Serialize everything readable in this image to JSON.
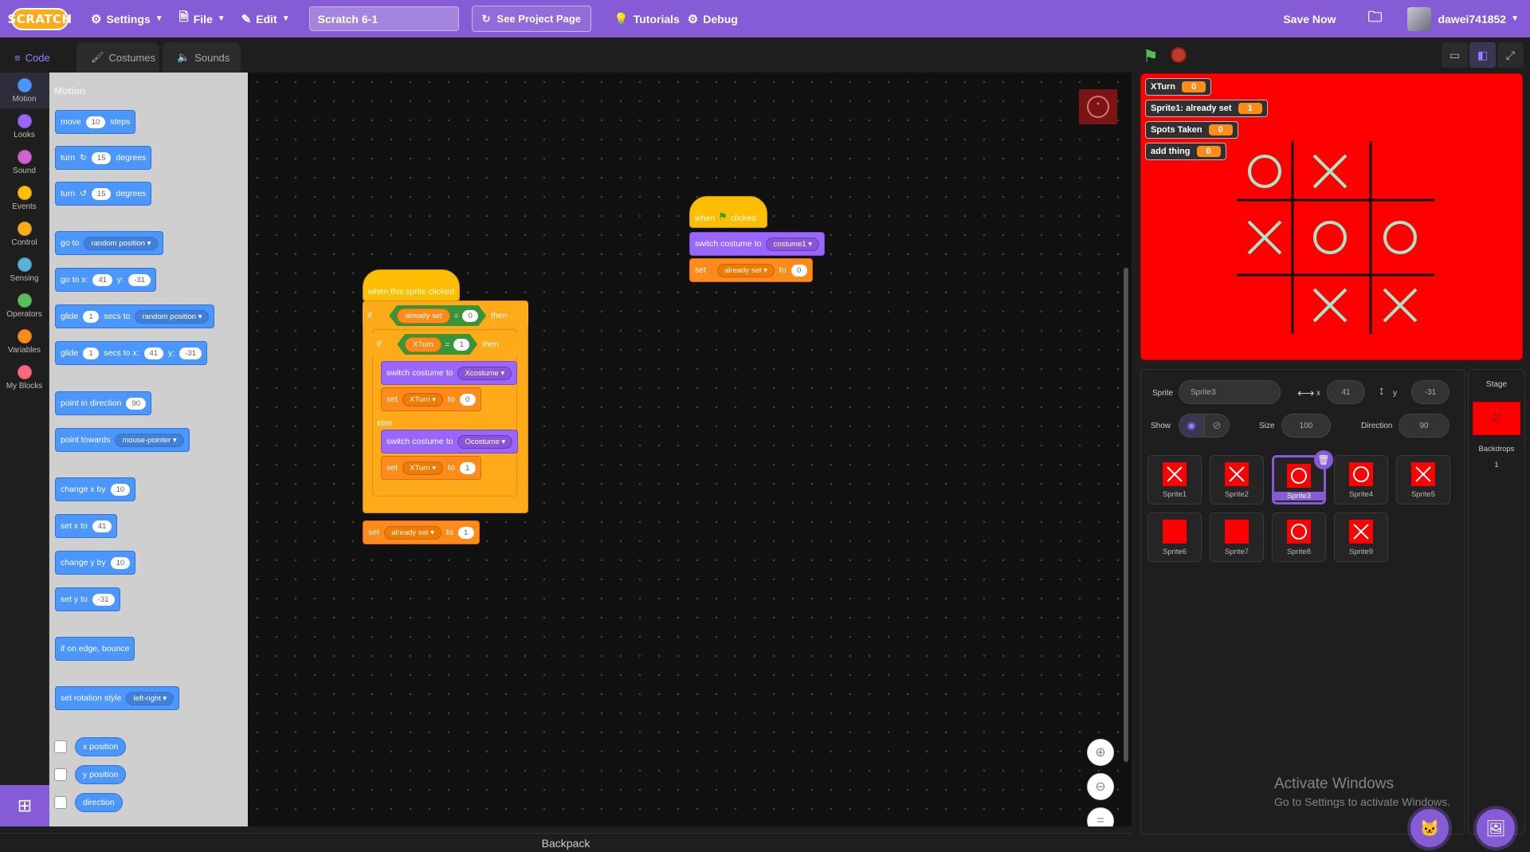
{
  "menubar": {
    "logo": "SCRATCH",
    "settings": "Settings",
    "file": "File",
    "edit": "Edit",
    "project_title": "Scratch 6-1",
    "see_project": "See Project Page",
    "tutorials": "Tutorials",
    "debug": "Debug",
    "save_now": "Save Now",
    "username": "dawei741852"
  },
  "tabs": [
    "Code",
    "Costumes",
    "Sounds"
  ],
  "categories": [
    {
      "label": "Motion",
      "color": "#4c97ff"
    },
    {
      "label": "Looks",
      "color": "#9966ff"
    },
    {
      "label": "Sound",
      "color": "#cf63cf"
    },
    {
      "label": "Events",
      "color": "#ffbf00"
    },
    {
      "label": "Control",
      "color": "#ffab19"
    },
    {
      "label": "Sensing",
      "color": "#5cb1d6"
    },
    {
      "label": "Operators",
      "color": "#59c059"
    },
    {
      "label": "Variables",
      "color": "#ff8c1a"
    },
    {
      "label": "My Blocks",
      "color": "#ff6680"
    }
  ],
  "palette": {
    "heading": "Motion",
    "move": {
      "a": "move",
      "v": "10",
      "b": "steps"
    },
    "turn_right": {
      "a": "turn",
      "v": "15",
      "b": "degrees"
    },
    "turn_left": {
      "a": "turn",
      "v": "15",
      "b": "degrees"
    },
    "goto": {
      "a": "go to",
      "d": "random position"
    },
    "goto_xy": {
      "a": "go to x:",
      "x": "41",
      "b": "y:",
      "y": "-31"
    },
    "glide": {
      "a": "glide",
      "v": "1",
      "b": "secs to",
      "d": "random position"
    },
    "glide_xy": {
      "a": "glide",
      "v": "1",
      "b": "secs to x:",
      "x": "41",
      "c": "y:",
      "y": "-31"
    },
    "point_dir": {
      "a": "point in direction",
      "v": "90"
    },
    "point_towards": {
      "a": "point towards",
      "d": "mouse-pointer"
    },
    "change_x": {
      "a": "change x by",
      "v": "10"
    },
    "set_x": {
      "a": "set x to",
      "v": "41"
    },
    "change_y": {
      "a": "change y by",
      "v": "10"
    },
    "set_y": {
      "a": "set y to",
      "v": "-31"
    },
    "bounce": "if on edge, bounce",
    "rotation": {
      "a": "set rotation style",
      "d": "left-right"
    },
    "reporters": [
      "x position",
      "y position",
      "direction"
    ]
  },
  "scripts": {
    "sprite_clicked": {
      "hat": "when this sprite clicked",
      "if1": {
        "kw": "if",
        "var": "already set",
        "eq": "=",
        "val": "0",
        "then": "then"
      },
      "if2": {
        "kw": "if",
        "var": "XTurn",
        "eq": "=",
        "val": "1",
        "then": "then"
      },
      "switch1": {
        "a": "switch costume to",
        "d": "Xcostume"
      },
      "set1": {
        "a": "set",
        "d": "XTurn",
        "b": "to",
        "v": "0"
      },
      "else": "else",
      "switch2": {
        "a": "switch costume to",
        "d": "Ocostume"
      },
      "set2": {
        "a": "set",
        "d": "XTurn",
        "b": "to",
        "v": "1"
      },
      "set3": {
        "a": "set",
        "d": "already set",
        "b": "to",
        "v": "1"
      }
    },
    "flag_clicked": {
      "hat_a": "when",
      "hat_b": "clicked",
      "switch": {
        "a": "switch costume to",
        "d": "costume1"
      },
      "set": {
        "a": "set",
        "d": "already set",
        "b": "to",
        "v": "0"
      }
    }
  },
  "backpack": "Backpack",
  "stage": {
    "monitors": [
      {
        "label": "XTurn",
        "value": "0"
      },
      {
        "label": "Sprite1: already set",
        "value": "1"
      },
      {
        "label": "Spots Taken",
        "value": "0"
      },
      {
        "label": "add thing",
        "value": "0"
      }
    ],
    "board": [
      [
        "O",
        "X",
        ""
      ],
      [
        "X",
        "O",
        "O"
      ],
      [
        "",
        "X",
        "X"
      ]
    ]
  },
  "sprite_info": {
    "sprite_label": "Sprite",
    "sprite_name": "Sprite3",
    "x_label": "x",
    "x": "41",
    "y_label": "y",
    "y": "-31",
    "show_label": "Show",
    "size_label": "Size",
    "size": "100",
    "direction_label": "Direction",
    "direction": "90"
  },
  "sprites": [
    {
      "name": "Sprite1",
      "costume": "X"
    },
    {
      "name": "Sprite2",
      "costume": "X"
    },
    {
      "name": "Sprite3",
      "costume": "O"
    },
    {
      "name": "Sprite4",
      "costume": "O"
    },
    {
      "name": "Sprite5",
      "costume": "X"
    },
    {
      "name": "Sprite6",
      "costume": ""
    },
    {
      "name": "Sprite7",
      "costume": ""
    },
    {
      "name": "Sprite8",
      "costume": "O"
    },
    {
      "name": "Sprite9",
      "costume": "X"
    }
  ],
  "stage_panel": {
    "title": "Stage",
    "backdrops_label": "Backdrops",
    "backdrops_count": "1"
  },
  "watermark": {
    "line1": "Activate Windows",
    "line2": "Go to Settings to activate Windows."
  },
  "colors": {
    "accent": "#855cd6",
    "stage_bg": "#ff0000",
    "motion": "#4c97ff"
  }
}
